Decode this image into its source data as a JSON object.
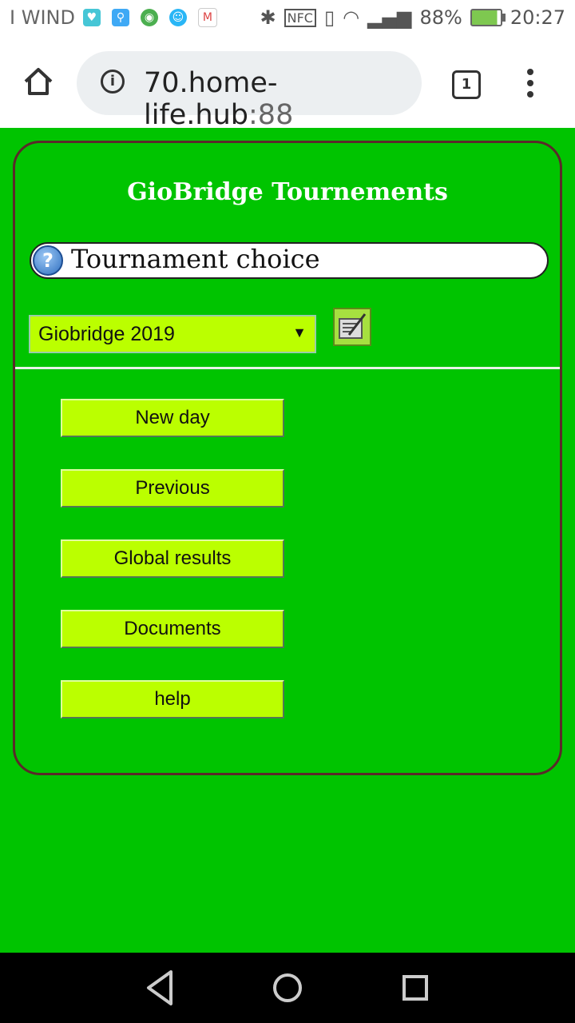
{
  "status_bar": {
    "carrier": "I WIND",
    "battery_percent": "88%",
    "time": "20:27",
    "nfc": "NFC"
  },
  "browser": {
    "url_host": "70.home-life.hub",
    "url_port": ":88",
    "tab_count": "1"
  },
  "page": {
    "title": "GioBridge Tournements",
    "choice_label": "Tournament choice",
    "help_glyph": "?",
    "selected_tournament": "Giobridge 2019",
    "menu": [
      {
        "label": "New day"
      },
      {
        "label": "Previous"
      },
      {
        "label": "Global results"
      },
      {
        "label": "Documents"
      },
      {
        "label": "help"
      }
    ]
  },
  "colors": {
    "page_bg": "#00c400",
    "button_bg": "#bbff00",
    "panel_border": "#5a2a2a"
  }
}
